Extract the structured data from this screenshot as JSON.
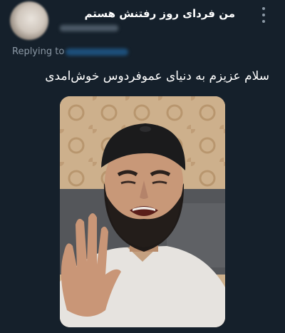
{
  "header": {
    "display_name": "من فردای روز رفتنش هستم",
    "more_icon": "more-vertical-icon"
  },
  "reply": {
    "prefix": "Replying to"
  },
  "tweet": {
    "text": "سلام عزیزم به دنیای عموفردوس خوش‌امدی"
  },
  "colors": {
    "background": "#15202b",
    "secondary_text": "#8b98a5",
    "link": "#1d9bf0"
  }
}
